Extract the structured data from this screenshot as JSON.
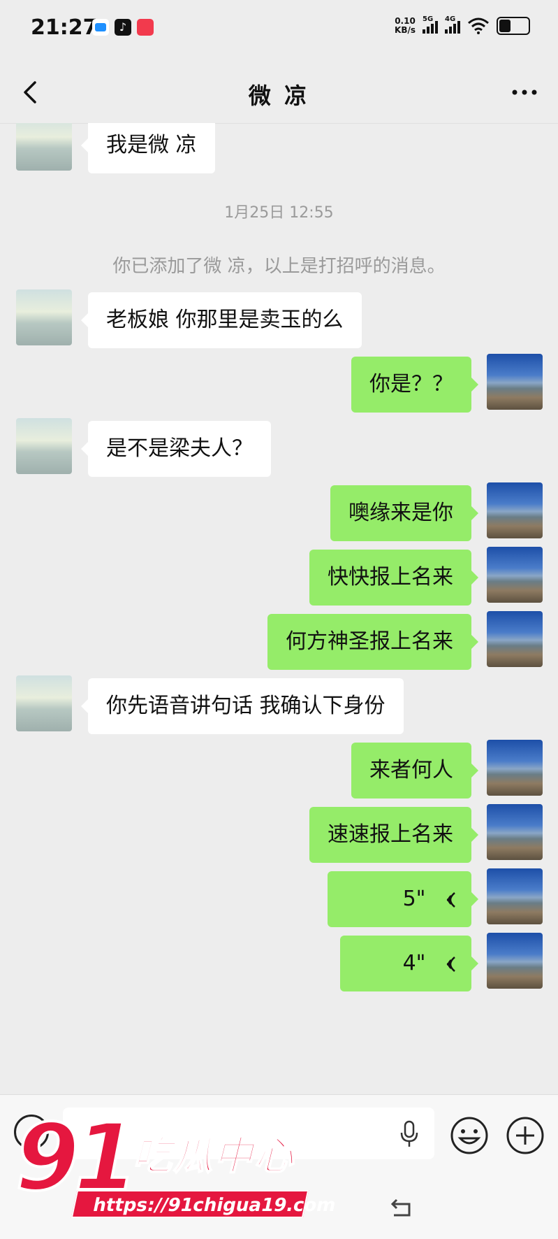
{
  "status_bar": {
    "time": "21:27",
    "net_speed_value": "0.10",
    "net_speed_unit": "KB/s",
    "signal1": "5G",
    "signal2": "4G",
    "app_icons": [
      "cloud-app-icon",
      "tiktok-icon",
      "red-app-icon"
    ]
  },
  "header": {
    "title": "微 凉"
  },
  "messages": [
    {
      "side": "left",
      "text": "我是微 凉"
    },
    {
      "type": "time",
      "text": "1月25日 12:55"
    },
    {
      "type": "system",
      "text": "你已添加了微 凉，以上是打招呼的消息。"
    },
    {
      "side": "left",
      "text": "老板娘 你那里是卖玉的么"
    },
    {
      "side": "right",
      "text": "你是？？"
    },
    {
      "side": "left",
      "text": "是不是梁夫人？"
    },
    {
      "side": "right",
      "text": "噢缘来是你"
    },
    {
      "side": "right",
      "text": "快快报上名来"
    },
    {
      "side": "right",
      "text": "何方神圣报上名来"
    },
    {
      "side": "left",
      "text": "你先语音讲句话 我确认下身份"
    },
    {
      "side": "right",
      "text": "来者何人"
    },
    {
      "side": "right",
      "text": "速速报上名来"
    },
    {
      "side": "right",
      "type": "voice",
      "text": "5\""
    },
    {
      "side": "right",
      "type": "voice",
      "text": "4\""
    }
  ],
  "watermark": {
    "number": "91",
    "name": "吃瓜中心",
    "url": "https://91chigua19.com"
  },
  "colors": {
    "background": "#ededed",
    "outgoing_bubble": "#95ec69",
    "incoming_bubble": "#ffffff",
    "watermark_red": "#e5173f"
  }
}
